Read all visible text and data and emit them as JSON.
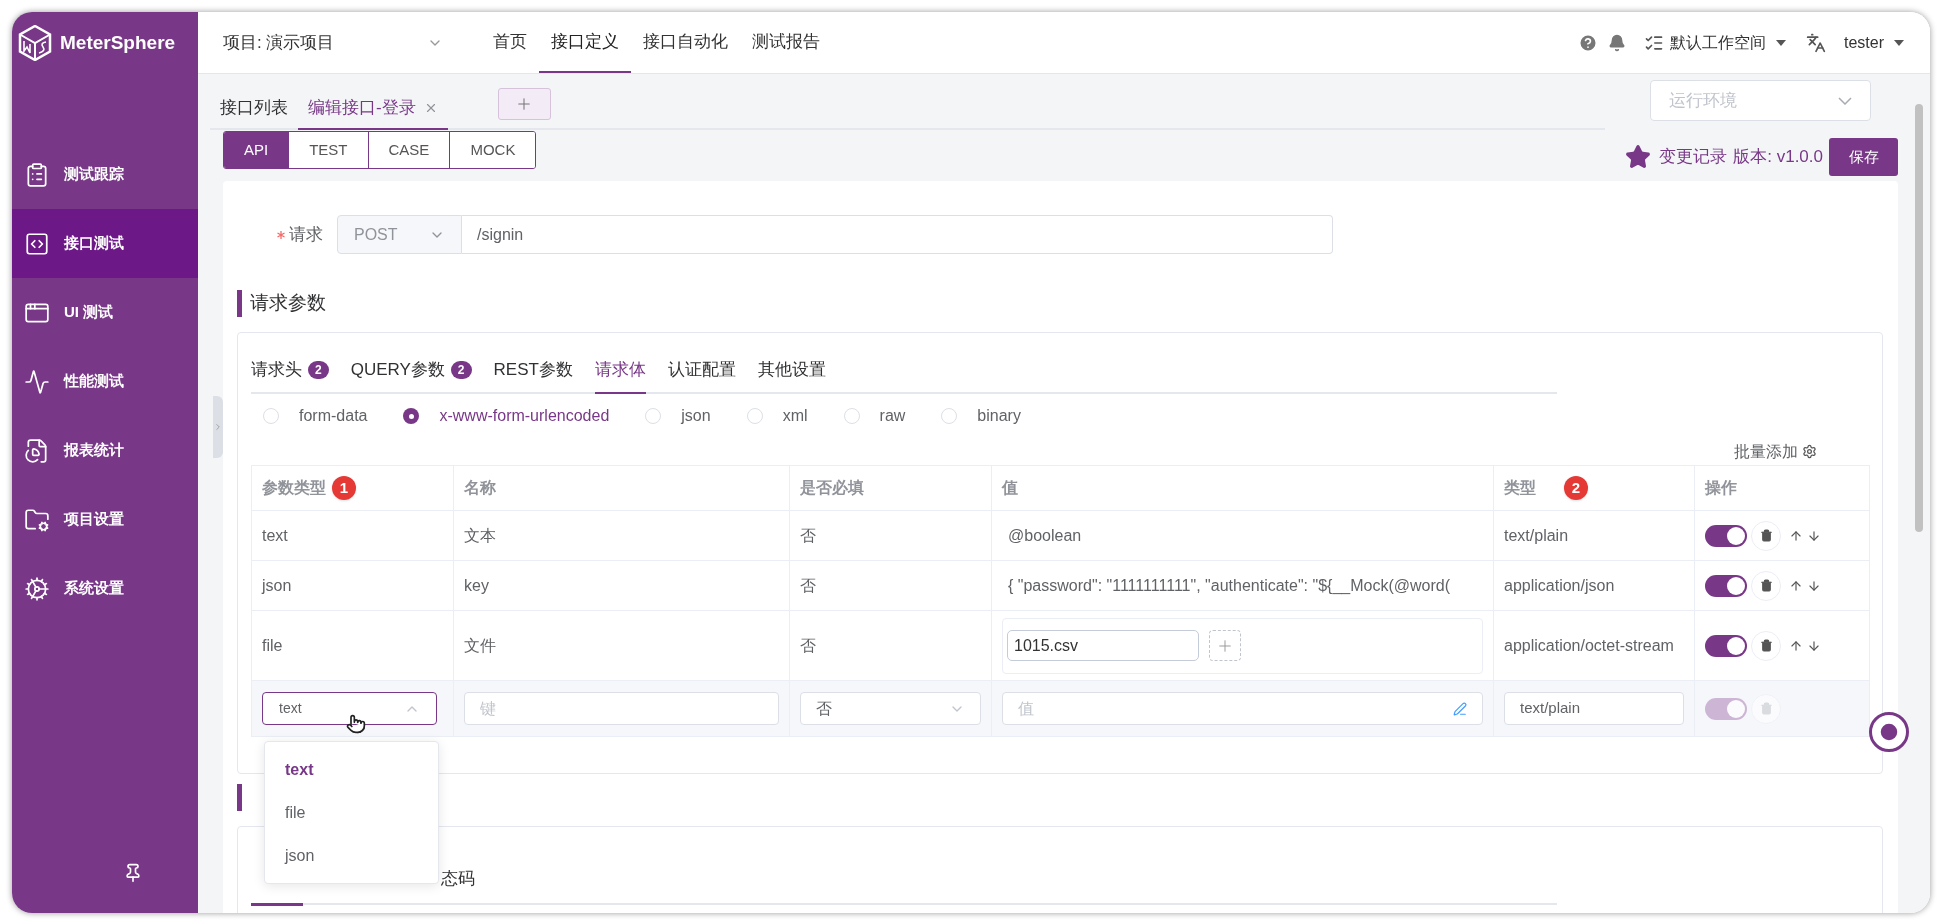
{
  "app": {
    "logo_text": "MeterSphere",
    "project": "项目: 演示项目"
  },
  "top_nav": [
    {
      "label": "首页",
      "selected": false
    },
    {
      "label": "接口定义",
      "selected": true
    },
    {
      "label": "接口自动化",
      "selected": false
    },
    {
      "label": "测试报告",
      "selected": false
    }
  ],
  "header_right": {
    "workspace": "默认工作空间",
    "user": "tester"
  },
  "sidebar": {
    "items": [
      {
        "kind": "clipboard",
        "label": "测试跟踪",
        "selected": false
      },
      {
        "kind": "api",
        "label": "接口测试",
        "selected": true
      },
      {
        "kind": "ui",
        "label": "UI 测试",
        "selected": false
      },
      {
        "kind": "performance",
        "label": "性能测试",
        "selected": false
      },
      {
        "kind": "report",
        "label": "报表统计",
        "selected": false
      },
      {
        "kind": "project",
        "label": "项目设置",
        "selected": false
      },
      {
        "kind": "system",
        "label": "系统设置",
        "selected": false
      }
    ]
  },
  "editor_tabs": [
    {
      "label": "接口列表",
      "selected": false,
      "closable": false
    },
    {
      "label": "编辑接口-登录",
      "selected": true,
      "closable": true
    }
  ],
  "environment_select": {
    "placeholder": "运行环境"
  },
  "mode_tabs": [
    {
      "label": "API",
      "selected": true
    },
    {
      "label": "TEST",
      "selected": false
    },
    {
      "label": "CASE",
      "selected": false
    },
    {
      "label": "MOCK",
      "selected": false
    }
  ],
  "version_bar": {
    "history": "变更记录",
    "version": "版本: v1.0.0",
    "save": "保存"
  },
  "request": {
    "label": "请求",
    "required": true,
    "method": "POST",
    "url": "/signin"
  },
  "params_section": {
    "title": "请求参数",
    "tabs": [
      {
        "label": "请求头",
        "count": "2",
        "selected": false
      },
      {
        "label": "QUERY参数",
        "count": "2",
        "selected": false
      },
      {
        "label": "REST参数",
        "selected": false
      },
      {
        "label": "请求体",
        "selected": true
      },
      {
        "label": "认证配置",
        "selected": false
      },
      {
        "label": "其他设置",
        "selected": false
      }
    ],
    "body_types": [
      {
        "label": "form-data",
        "selected": false
      },
      {
        "label": "x-www-form-urlencoded",
        "selected": true
      },
      {
        "label": "json",
        "selected": false
      },
      {
        "label": "xml",
        "selected": false
      },
      {
        "label": "raw",
        "selected": false
      },
      {
        "label": "binary",
        "selected": false
      }
    ],
    "batch_add": "批量添加",
    "table": {
      "columns": [
        {
          "label": "参数类型",
          "badge": "1"
        },
        {
          "label": "名称"
        },
        {
          "label": "是否必填"
        },
        {
          "label": "值"
        },
        {
          "label": "类型",
          "badge": "2"
        },
        {
          "label": "操作"
        }
      ],
      "rows": [
        {
          "kind": "text",
          "param_type": "text",
          "name": "文本",
          "required": "否",
          "value": "@boolean",
          "content_type": "text/plain",
          "enabled": true
        },
        {
          "kind": "text",
          "param_type": "json",
          "name": "key",
          "required": "否",
          "value": "{ \"password\": \"1111111111\", \"authenticate\": \"${__Mock(@word(",
          "content_type": "application/json",
          "enabled": true
        },
        {
          "kind": "file",
          "param_type": "file",
          "name": "文件",
          "required": "否",
          "value": "1015.csv",
          "content_type": "application/octet-stream",
          "enabled": true
        }
      ],
      "new_row": {
        "param_type": "text",
        "name_placeholder": "键",
        "required": "否",
        "value_placeholder": "值",
        "content_type": "text/plain",
        "enabled": true,
        "disabled": true
      }
    },
    "dropdown": {
      "options": [
        {
          "label": "text",
          "selected": true
        },
        {
          "label": "file",
          "selected": false
        },
        {
          "label": "json",
          "selected": false
        }
      ]
    }
  },
  "response_section": {
    "tab_fragment": "态码"
  }
}
